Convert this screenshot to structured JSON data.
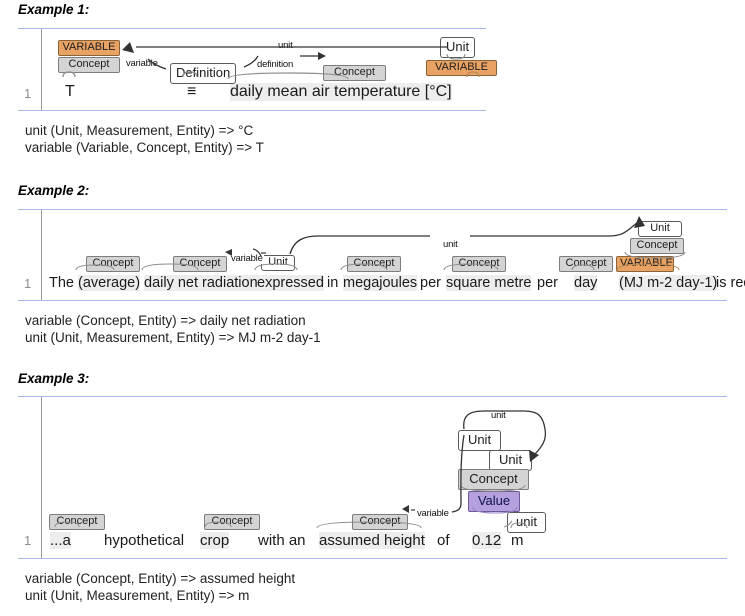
{
  "page": {
    "colors": {
      "variable_tag": "#e8a263",
      "concept_tag": "#d4d4d4",
      "value_tag": "#b3a0dd",
      "rule": "#aab6e8",
      "gutter": "#9a9a9a",
      "token_highlight": "#ededed"
    }
  },
  "examples": [
    {
      "title": "Example 1:",
      "line_number": "1",
      "tokens": [
        {
          "text": "T"
        },
        {
          "text": "≡"
        },
        {
          "text": "daily mean air temperature [°C]"
        }
      ],
      "tags": [
        {
          "label": "VARIABLE",
          "kind": "orange"
        },
        {
          "label": "Concept",
          "kind": "gray"
        },
        {
          "label": "Definition",
          "kind": "white"
        },
        {
          "label": "Concept",
          "kind": "gray"
        },
        {
          "label": "Unit",
          "kind": "white"
        },
        {
          "label": "VARIABLE",
          "kind": "orange"
        }
      ],
      "edges": [
        {
          "label": "variable"
        },
        {
          "label": "definition"
        },
        {
          "label": "unit"
        }
      ],
      "annotations": [
        "unit (Unit, Measurement, Entity) => °C",
        "variable (Variable, Concept, Entity) => T"
      ]
    },
    {
      "title": "Example 2:",
      "line_number": "1",
      "tokens": [
        {
          "text": "The"
        },
        {
          "text": "(average)"
        },
        {
          "text": "daily net radiation"
        },
        {
          "text": "expressed"
        },
        {
          "text": "in"
        },
        {
          "text": "megajoules"
        },
        {
          "text": "per"
        },
        {
          "text": "square metre"
        },
        {
          "text": "per"
        },
        {
          "text": "day"
        },
        {
          "text": "(MJ m-2 day-1)"
        },
        {
          "text": "is required."
        }
      ],
      "tags": [
        {
          "label": "Concept",
          "kind": "gray"
        },
        {
          "label": "Concept",
          "kind": "gray"
        },
        {
          "label": "Unit",
          "kind": "white"
        },
        {
          "label": "Concept",
          "kind": "gray"
        },
        {
          "label": "Concept",
          "kind": "gray"
        },
        {
          "label": "Concept",
          "kind": "gray"
        },
        {
          "label": "VARIABLE",
          "kind": "orange"
        },
        {
          "label": "Unit",
          "kind": "white"
        },
        {
          "label": "Concept",
          "kind": "gray"
        }
      ],
      "edges": [
        {
          "label": "variable"
        },
        {
          "label": "unit"
        }
      ],
      "annotations": [
        "variable (Concept, Entity) => daily net radiation",
        "unit (Unit, Measurement, Entity) => MJ m-2 day-1"
      ]
    },
    {
      "title": "Example 3:",
      "line_number": "1",
      "tokens": [
        {
          "text": "...a"
        },
        {
          "text": "hypothetical"
        },
        {
          "text": "crop"
        },
        {
          "text": "with an"
        },
        {
          "text": "assumed height"
        },
        {
          "text": "of"
        },
        {
          "text": "0.12"
        },
        {
          "text": "m"
        }
      ],
      "tags": [
        {
          "label": "Concept",
          "kind": "gray"
        },
        {
          "label": "Concept",
          "kind": "gray"
        },
        {
          "label": "Concept",
          "kind": "gray"
        },
        {
          "label": "Unit",
          "kind": "white"
        },
        {
          "label": "Unit",
          "kind": "white"
        },
        {
          "label": "Concept",
          "kind": "gray"
        },
        {
          "label": "Value",
          "kind": "purple"
        },
        {
          "label": "unit",
          "kind": "white"
        }
      ],
      "edges": [
        {
          "label": "unit"
        },
        {
          "label": "variable"
        },
        {
          "label": "unit"
        }
      ],
      "annotations": [
        "variable (Concept, Entity) => assumed height",
        "unit (Unit, Measurement, Entity) => m"
      ]
    }
  ]
}
